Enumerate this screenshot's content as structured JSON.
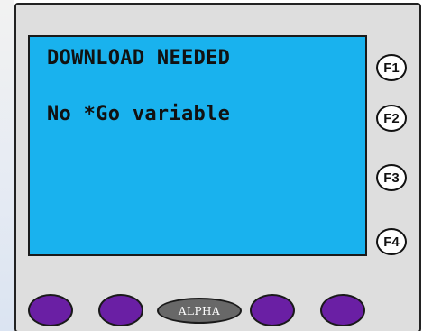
{
  "display": {
    "line1": "DOWNLOAD NEEDED",
    "line2": "No *Go variable",
    "background_color": "#19b2ee",
    "text_color": "#111111"
  },
  "function_keys": [
    {
      "label": "F1"
    },
    {
      "label": "F2"
    },
    {
      "label": "F3"
    },
    {
      "label": "F4"
    }
  ],
  "bottom_keys": {
    "alpha_label": "ALPHA",
    "softkey_color": "#6a1fa4",
    "alpha_color": "#686868"
  },
  "panel": {
    "color": "#dedede"
  }
}
